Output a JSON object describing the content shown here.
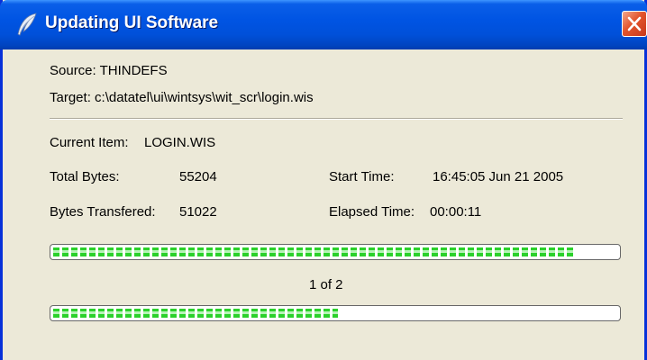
{
  "window": {
    "title": "Updating UI Software",
    "icon": "feather-icon",
    "close": "close-icon"
  },
  "source": "Source: THINDEFS",
  "target": "Target: c:\\datatel\\ui\\wintsys\\wit_scr\\login.wis",
  "current_item": {
    "label": "Current Item:",
    "value": "LOGIN.WIS"
  },
  "total_bytes": {
    "label": "Total Bytes:",
    "value": "55204"
  },
  "bytes_transfered": {
    "label": "Bytes Transfered:",
    "value": "51022"
  },
  "start_time": {
    "label": "Start Time:",
    "value": "16:45:05 Jun 21 2005"
  },
  "elapsed_time": {
    "label": "Elapsed Time:",
    "value": "00:00:11"
  },
  "item_progress": {
    "percent": 92.4
  },
  "item_counter": "1 of 2",
  "overall_progress": {
    "percent": 50.5
  },
  "colors": {
    "titlebar": "#0054e3",
    "progress_fill": "#2bd12b",
    "dialog_bg": "#ece9d8"
  }
}
